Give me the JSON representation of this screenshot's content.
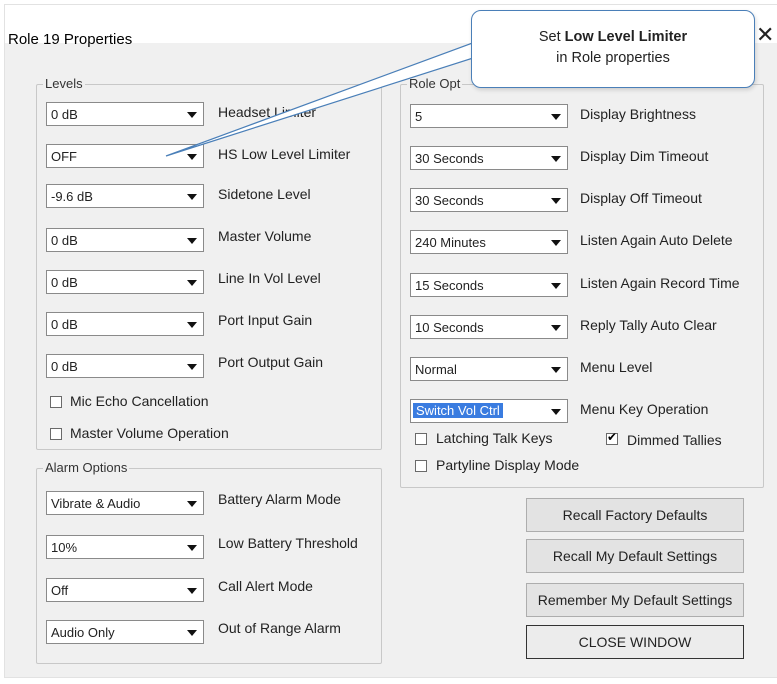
{
  "window": {
    "title": "Role 19 Properties",
    "close_glyph": "✕",
    "close_icon": "close-icon"
  },
  "callout": {
    "line1_prefix": "Set ",
    "line1_bold": "Low Level Limiter",
    "line2": "in Role properties"
  },
  "levels": {
    "legend": "Levels",
    "rows": [
      {
        "value": "0 dB",
        "label": "Headset Limiter"
      },
      {
        "value": "OFF",
        "label": "HS Low Level Limiter"
      },
      {
        "value": "-9.6 dB",
        "label": "Sidetone Level"
      },
      {
        "value": "0 dB",
        "label": "Master Volume"
      },
      {
        "value": "0 dB",
        "label": "Line In Vol Level"
      },
      {
        "value": "0 dB",
        "label": "Port Input Gain"
      },
      {
        "value": "0 dB",
        "label": "Port Output Gain"
      }
    ],
    "checkboxes": [
      {
        "label": "Mic Echo Cancellation",
        "checked": false
      },
      {
        "label": "Master Volume Operation",
        "checked": false
      }
    ]
  },
  "alarm": {
    "legend": "Alarm Options",
    "rows": [
      {
        "value": "Vibrate & Audio",
        "label": "Battery Alarm Mode"
      },
      {
        "value": "10%",
        "label": "Low Battery Threshold"
      },
      {
        "value": "Off",
        "label": "Call Alert Mode"
      },
      {
        "value": "Audio Only",
        "label": "Out of Range Alarm"
      }
    ]
  },
  "role": {
    "legend": "Role Opt",
    "rows": [
      {
        "value": "5",
        "label": "Display Brightness"
      },
      {
        "value": "30 Seconds",
        "label": "Display Dim Timeout"
      },
      {
        "value": "30 Seconds",
        "label": "Display Off Timeout"
      },
      {
        "value": "240 Minutes",
        "label": "Listen Again Auto Delete"
      },
      {
        "value": "15 Seconds",
        "label": "Listen Again Record Time"
      },
      {
        "value": "10 Seconds",
        "label": "Reply Tally Auto Clear"
      },
      {
        "value": "Normal",
        "label": "Menu Level"
      },
      {
        "value": "Switch Vol Ctrl",
        "label": "Menu Key Operation"
      }
    ],
    "checkboxes": [
      {
        "label": "Latching Talk Keys",
        "checked": false
      },
      {
        "label": "Dimmed Tallies",
        "checked": true
      },
      {
        "label": "Partyline Display Mode",
        "checked": false
      }
    ]
  },
  "buttons": {
    "recall_factory": "Recall Factory Defaults",
    "recall_my": "Recall My Default Settings",
    "remember_my": "Remember My Default Settings",
    "close_window": "CLOSE WINDOW"
  },
  "colors": {
    "highlight": "#3a7ce0",
    "callout_border": "#4a7fb8",
    "dialog_bg": "#f0f0f0"
  }
}
